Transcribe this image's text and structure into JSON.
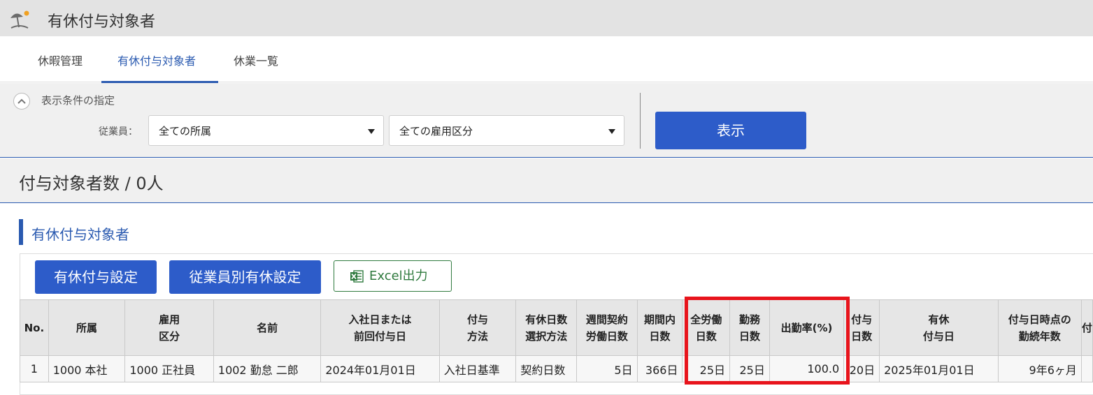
{
  "app": {
    "title": "有休付与対象者",
    "icon": "beach-umbrella-icon"
  },
  "tabs": [
    {
      "label": "休暇管理",
      "active": false
    },
    {
      "label": "有休付与対象者",
      "active": true
    },
    {
      "label": "休業一覧",
      "active": false
    }
  ],
  "filter": {
    "title": "表示条件の指定",
    "employee_label": "従業員：",
    "department_select": "全ての所属",
    "employment_select": "全ての雇用区分",
    "show_button": "表示"
  },
  "count_text": "付与対象者数 / 0人",
  "section_title": "有休付与対象者",
  "actions": {
    "grant_settings": "有休付与設定",
    "per_employee_settings": "従業員別有休設定",
    "excel_output": "Excel出力"
  },
  "table": {
    "headers": [
      [
        "No."
      ],
      [
        "所属"
      ],
      [
        "雇用",
        "区分"
      ],
      [
        "名前"
      ],
      [
        "入社日または",
        "前回付与日"
      ],
      [
        "付与",
        "方法"
      ],
      [
        "有休日数",
        "選択方法"
      ],
      [
        "週間契約",
        "労働日数"
      ],
      [
        "期間内",
        "日数"
      ],
      [
        "全労働",
        "日数"
      ],
      [
        "勤務",
        "日数"
      ],
      [
        "出勤率(%)"
      ],
      [
        "付与",
        "日数"
      ],
      [
        "有休",
        "付与日"
      ],
      [
        "付与日時点の",
        "勤続年数"
      ],
      [
        "付"
      ]
    ],
    "rows": [
      [
        "1",
        "1000 本社",
        "1000 正社員",
        "1002 勤怠 二郎",
        "2024年01月01日",
        "入社日基準",
        "契約日数",
        "5日",
        "366日",
        "25日",
        "25日",
        "100.0",
        "20日",
        "2025年01月01日",
        "9年6ヶ月",
        ""
      ]
    ]
  },
  "colors": {
    "accent": "#2a5ab0",
    "button": "#2d5cc9",
    "highlight": "#e8141c",
    "excel": "#2f7a3e"
  }
}
